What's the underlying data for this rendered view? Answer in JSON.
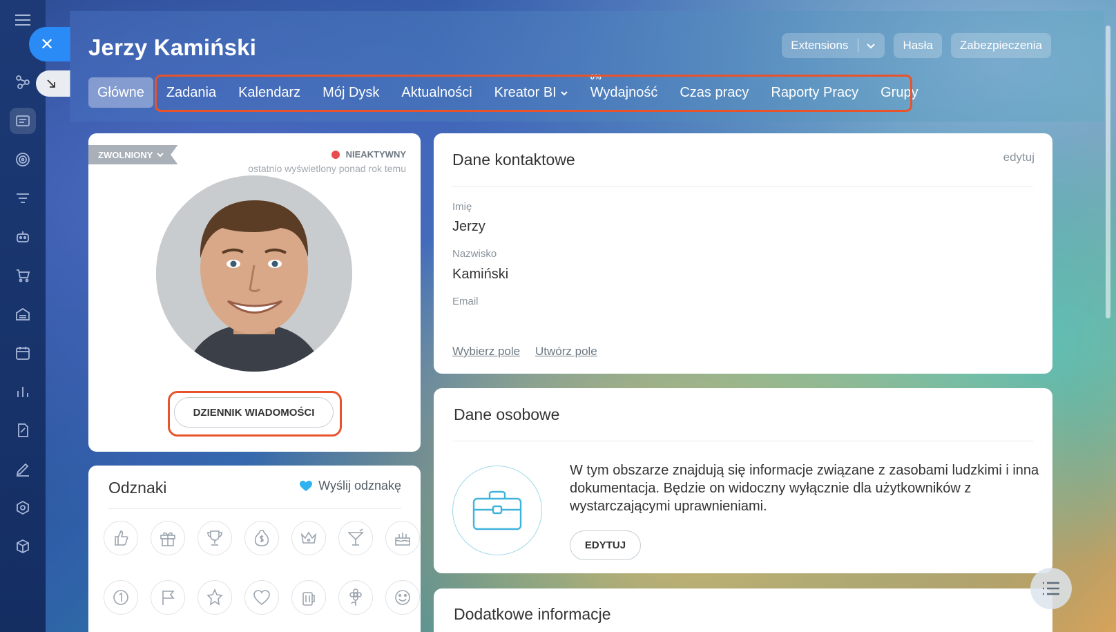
{
  "header": {
    "title": "Jerzy Kamiński",
    "extensions_label": "Extensions",
    "passwords_label": "Hasła",
    "security_label": "Zabezpieczenia"
  },
  "tabs": [
    {
      "label": "Główne",
      "active": true
    },
    {
      "label": "Zadania"
    },
    {
      "label": "Kalendarz"
    },
    {
      "label": "Mój Dysk"
    },
    {
      "label": "Aktualności"
    },
    {
      "label": "Kreator BI",
      "dropdown": true
    },
    {
      "label": "Wydajność",
      "badge": "0%"
    },
    {
      "label": "Czas pracy"
    },
    {
      "label": "Raporty Pracy"
    },
    {
      "label": "Grupy"
    }
  ],
  "profile": {
    "employment_status": "ZWOLNIONY",
    "online_status": "NIEAKTYWNY",
    "last_seen": "ostatnio wyświetlony ponad rok temu",
    "message_log_button": "DZIENNIK WIADOMOŚCI"
  },
  "badges": {
    "title": "Odznaki",
    "send_label": "Wyślij odznakę",
    "row1": [
      "thumbs-up-icon",
      "gift-icon",
      "trophy-icon",
      "money-bag-icon",
      "crown-icon",
      "cocktail-icon",
      "cake-icon"
    ],
    "row2": [
      "number-one-icon",
      "flag-icon",
      "star-icon",
      "heart-icon",
      "beer-icon",
      "flower-icon",
      "smile-icon"
    ]
  },
  "contact": {
    "title": "Dane kontaktowe",
    "edit_label": "edytuj",
    "first_name_label": "Imię",
    "first_name": "Jerzy",
    "last_name_label": "Nazwisko",
    "last_name": "Kamiński",
    "email_label": "Email",
    "choose_field": "Wybierz pole",
    "create_field": "Utwórz pole"
  },
  "personal": {
    "title": "Dane osobowe",
    "description": "W tym obszarze znajdują się informacje związane z zasobami ludzkimi i inna dokumentacja. Będzie on widoczny wyłącznie dla użytkowników z wystarczającymi uprawnieniami.",
    "edit_button": "EDYTUJ"
  },
  "extra": {
    "title": "Dodatkowe informacje"
  },
  "colors": {
    "accent_blue": "#2a8af6",
    "highlight_red": "#e8532c",
    "inactive_dot": "#e84c4c"
  }
}
